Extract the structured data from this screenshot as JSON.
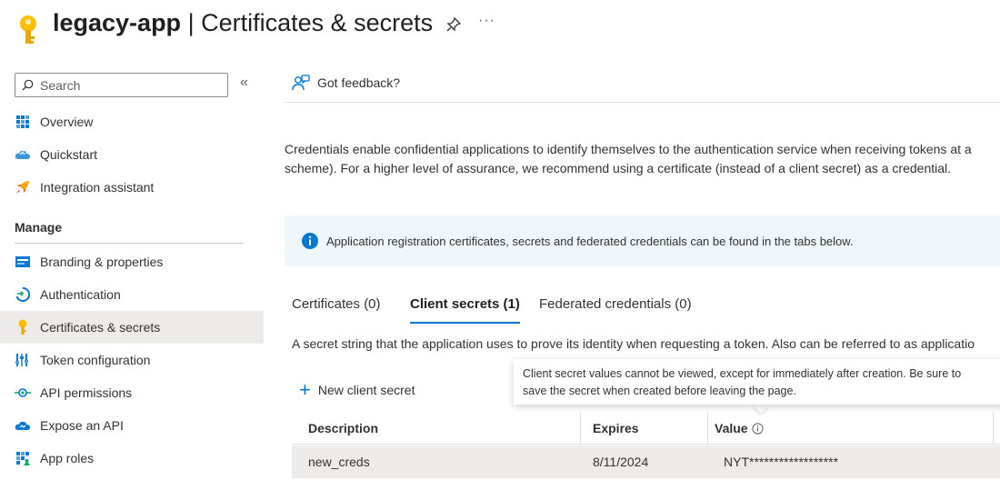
{
  "header": {
    "app_name": "legacy-app",
    "separator": " | ",
    "page_title": "Certificates & secrets",
    "more": "···",
    "key_color": "#f8c100"
  },
  "sidebar": {
    "search_placeholder": "Search",
    "collapse": "«",
    "items_top": [
      {
        "label": "Overview",
        "icon": "overview-grid-icon"
      },
      {
        "label": "Quickstart",
        "icon": "quickstart-cloud-icon"
      },
      {
        "label": "Integration assistant",
        "icon": "rocket-icon"
      }
    ],
    "section": "Manage",
    "items_manage": [
      {
        "label": "Branding & properties",
        "icon": "branding-icon"
      },
      {
        "label": "Authentication",
        "icon": "authentication-icon"
      },
      {
        "label": "Certificates & secrets",
        "icon": "key-icon",
        "selected": true
      },
      {
        "label": "Token configuration",
        "icon": "token-bars-icon"
      },
      {
        "label": "API permissions",
        "icon": "api-permissions-icon"
      },
      {
        "label": "Expose an API",
        "icon": "expose-api-cloud-icon"
      },
      {
        "label": "App roles",
        "icon": "app-roles-icon"
      }
    ]
  },
  "main": {
    "feedback": "Got feedback?",
    "description_line1": "Credentials enable confidential applications to identify themselves to the authentication service when receiving tokens at a",
    "description_line2": "scheme). For a higher level of assurance, we recommend using a certificate (instead of a client secret) as a credential.",
    "info_text": "Application registration certificates, secrets and federated credentials can be found in the tabs below.",
    "tabs": [
      {
        "label": "Certificates (0)"
      },
      {
        "label": "Client secrets (1)",
        "active": true
      },
      {
        "label": "Federated credentials (0)"
      }
    ],
    "secret_description": "A secret string that the application uses to prove its identity when requesting a token. Also can be referred to as applicatio",
    "new_secret_label": "New client secret",
    "tooltip_line1": "Client secret values cannot be viewed, except for immediately after creation. Be sure to",
    "tooltip_line2": "save the secret when created before leaving the page.",
    "table": {
      "columns": [
        "Description",
        "Expires",
        "Value"
      ],
      "rows": [
        {
          "description": "new_creds",
          "expires": "8/11/2024",
          "value": "NYT******************"
        }
      ]
    },
    "accent_color": "#0078d4"
  }
}
